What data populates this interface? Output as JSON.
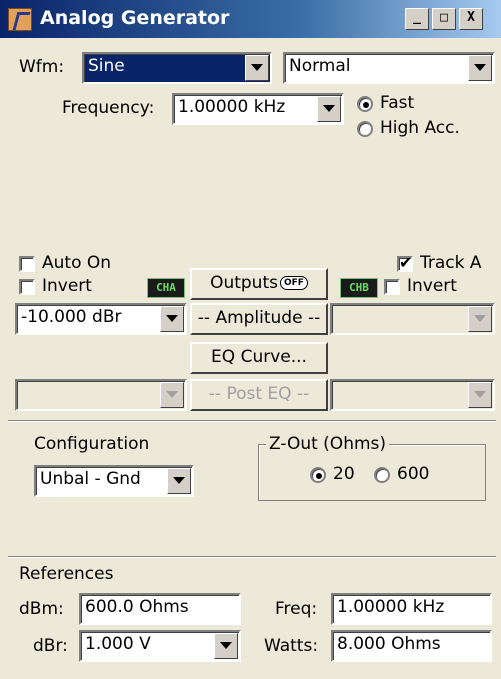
{
  "window": {
    "title": "Analog Generator",
    "minimize": "_",
    "maximize": "□",
    "close": "X"
  },
  "wfm": {
    "label": "Wfm:",
    "value": "Sine",
    "mode_value": "Normal"
  },
  "frequency": {
    "label": "Frequency:",
    "value": "1.00000 kHz"
  },
  "speed": {
    "fast_label": "Fast",
    "high_acc_label": "High Acc.",
    "selected": "Fast"
  },
  "channel_a": {
    "auto_on_label": "Auto On",
    "invert_label": "Invert",
    "badge": "CHA",
    "auto_on": false,
    "invert": false
  },
  "channel_b": {
    "track_label": "Track A",
    "invert_label": "Invert",
    "badge": "CHB",
    "track": true,
    "invert": false
  },
  "outputs": {
    "label": "Outputs",
    "state_badge": "OFF"
  },
  "amplitude": {
    "label": "-- Amplitude --",
    "ch_a_value": "-10.000  dBr",
    "ch_b_value": ""
  },
  "eq": {
    "curve_label": "EQ Curve...",
    "post_eq_label": "-- Post EQ --"
  },
  "configuration": {
    "label": "Configuration",
    "value": "Unbal - Gnd"
  },
  "zout": {
    "label": "Z-Out (Ohms)",
    "option1": "20",
    "option2": "600",
    "selected": "20"
  },
  "references": {
    "title": "References",
    "dbm_label": "dBm:",
    "dbm_value": "600.0    Ohms",
    "freq_label": "Freq:",
    "freq_value": "1.00000 kHz",
    "dbr_label": "dBr:",
    "dbr_value": "1.000    V",
    "watts_label": "Watts:",
    "watts_value": "8.000    Ohms"
  }
}
